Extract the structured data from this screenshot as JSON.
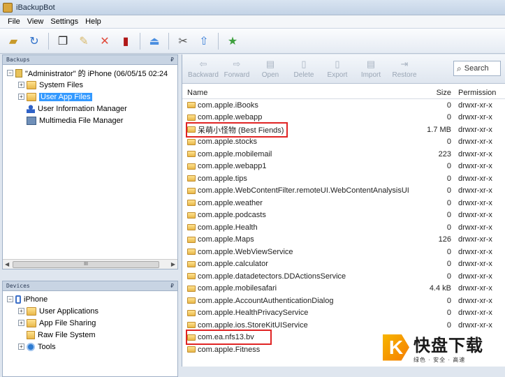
{
  "window": {
    "title": "iBackupBot"
  },
  "menu": [
    "File",
    "View",
    "Settings",
    "Help"
  ],
  "backups_panel": {
    "header": "Backups",
    "pin": "₽",
    "root": "\"Administrator\" 的 iPhone (06/05/15 02:24",
    "items": [
      "System Files",
      "User App Files",
      "User Information Manager",
      "Multimedia File Manager"
    ],
    "scroll_mid": "III"
  },
  "devices_panel": {
    "header": "Devices",
    "pin": "₽",
    "root": "iPhone",
    "items": [
      "User Applications",
      "App File Sharing",
      "Raw File System",
      "Tools"
    ]
  },
  "file_toolbar": {
    "buttons": [
      "Backward",
      "Forward",
      "Open",
      "Delete",
      "Export",
      "Import",
      "Restore"
    ],
    "search_label": "Search"
  },
  "file_list": {
    "columns": [
      "Name",
      "Size",
      "Permission"
    ],
    "rows": [
      {
        "name": "com.apple.iBooks",
        "size": "0",
        "perm": "drwxr-xr-x"
      },
      {
        "name": "com.apple.webapp",
        "size": "0",
        "perm": "drwxr-xr-x"
      },
      {
        "name": "呆萌小怪物 (Best Fiends)",
        "size": "1.7 MB",
        "perm": "drwxr-xr-x"
      },
      {
        "name": "com.apple.stocks",
        "size": "0",
        "perm": "drwxr-xr-x"
      },
      {
        "name": "com.apple.mobilemail",
        "size": "223",
        "perm": "drwxr-xr-x"
      },
      {
        "name": "com.apple.webapp1",
        "size": "0",
        "perm": "drwxr-xr-x"
      },
      {
        "name": "com.apple.tips",
        "size": "0",
        "perm": "drwxr-xr-x"
      },
      {
        "name": "com.apple.WebContentFilter.remoteUI.WebContentAnalysisUI",
        "size": "0",
        "perm": "drwxr-xr-x"
      },
      {
        "name": "com.apple.weather",
        "size": "0",
        "perm": "drwxr-xr-x"
      },
      {
        "name": "com.apple.podcasts",
        "size": "0",
        "perm": "drwxr-xr-x"
      },
      {
        "name": "com.apple.Health",
        "size": "0",
        "perm": "drwxr-xr-x"
      },
      {
        "name": "com.apple.Maps",
        "size": "126",
        "perm": "drwxr-xr-x"
      },
      {
        "name": "com.apple.WebViewService",
        "size": "0",
        "perm": "drwxr-xr-x"
      },
      {
        "name": "com.apple.calculator",
        "size": "0",
        "perm": "drwxr-xr-x"
      },
      {
        "name": "com.apple.datadetectors.DDActionsService",
        "size": "0",
        "perm": "drwxr-xr-x"
      },
      {
        "name": "com.apple.mobilesafari",
        "size": "4.4 kB",
        "perm": "drwxr-xr-x"
      },
      {
        "name": "com.apple.AccountAuthenticationDialog",
        "size": "0",
        "perm": "drwxr-xr-x"
      },
      {
        "name": "com.apple.HealthPrivacyService",
        "size": "0",
        "perm": "drwxr-xr-x"
      },
      {
        "name": "com.apple.ios.StoreKitUIService",
        "size": "0",
        "perm": "drwxr-xr-x"
      },
      {
        "name": "com.ea.nfs13.bv",
        "size": "",
        "perm": ""
      },
      {
        "name": "com.apple.Fitness",
        "size": "",
        "perm": ""
      }
    ]
  },
  "watermark": {
    "logo_letter": "K",
    "main": "快盘下载",
    "sub": "绿色 · 安全 · 高速"
  }
}
